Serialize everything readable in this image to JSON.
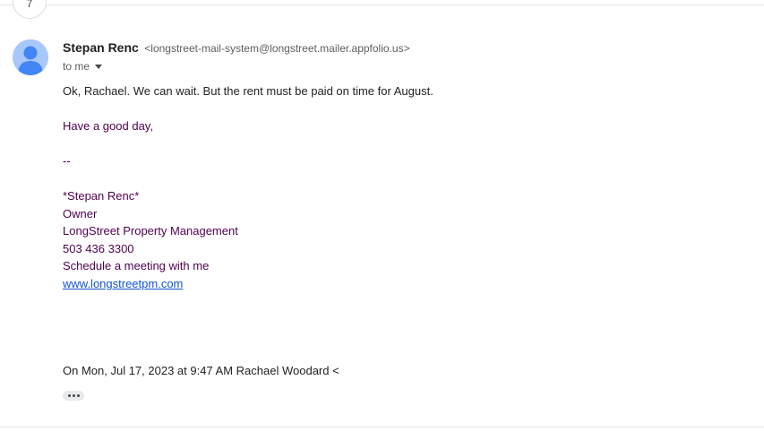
{
  "thread": {
    "collapsed_count": "7"
  },
  "message": {
    "sender_name": "Stepan Renc",
    "sender_email": "<longstreet-mail-system@longstreet.mailer.appfolio.us>",
    "recipient_label": "to me",
    "body": {
      "line1": "Ok, Rachael. We can wait. But the rent must be paid on time for August.",
      "line2": "Have a good day,",
      "separator": "--",
      "signature": {
        "name": "*Stepan Renc*",
        "title": "Owner",
        "company": "LongStreet Property Management",
        "phone": "503 436 3300",
        "schedule": "Schedule a meeting with me",
        "website": "www.longstreetpm.com"
      },
      "quote_header": "On Mon, Jul 17, 2023 at 9:47 AM Rachael Woodard <"
    }
  },
  "icons": {
    "avatar": "person-avatar-icon",
    "recipient_dropdown": "caret-down-icon",
    "show_trimmed": "ellipsis-icon"
  },
  "colors": {
    "avatar_bg": "#a8c7fa",
    "avatar_fg": "#4285f4",
    "signature_text": "#500050",
    "link": "#1155cc"
  }
}
